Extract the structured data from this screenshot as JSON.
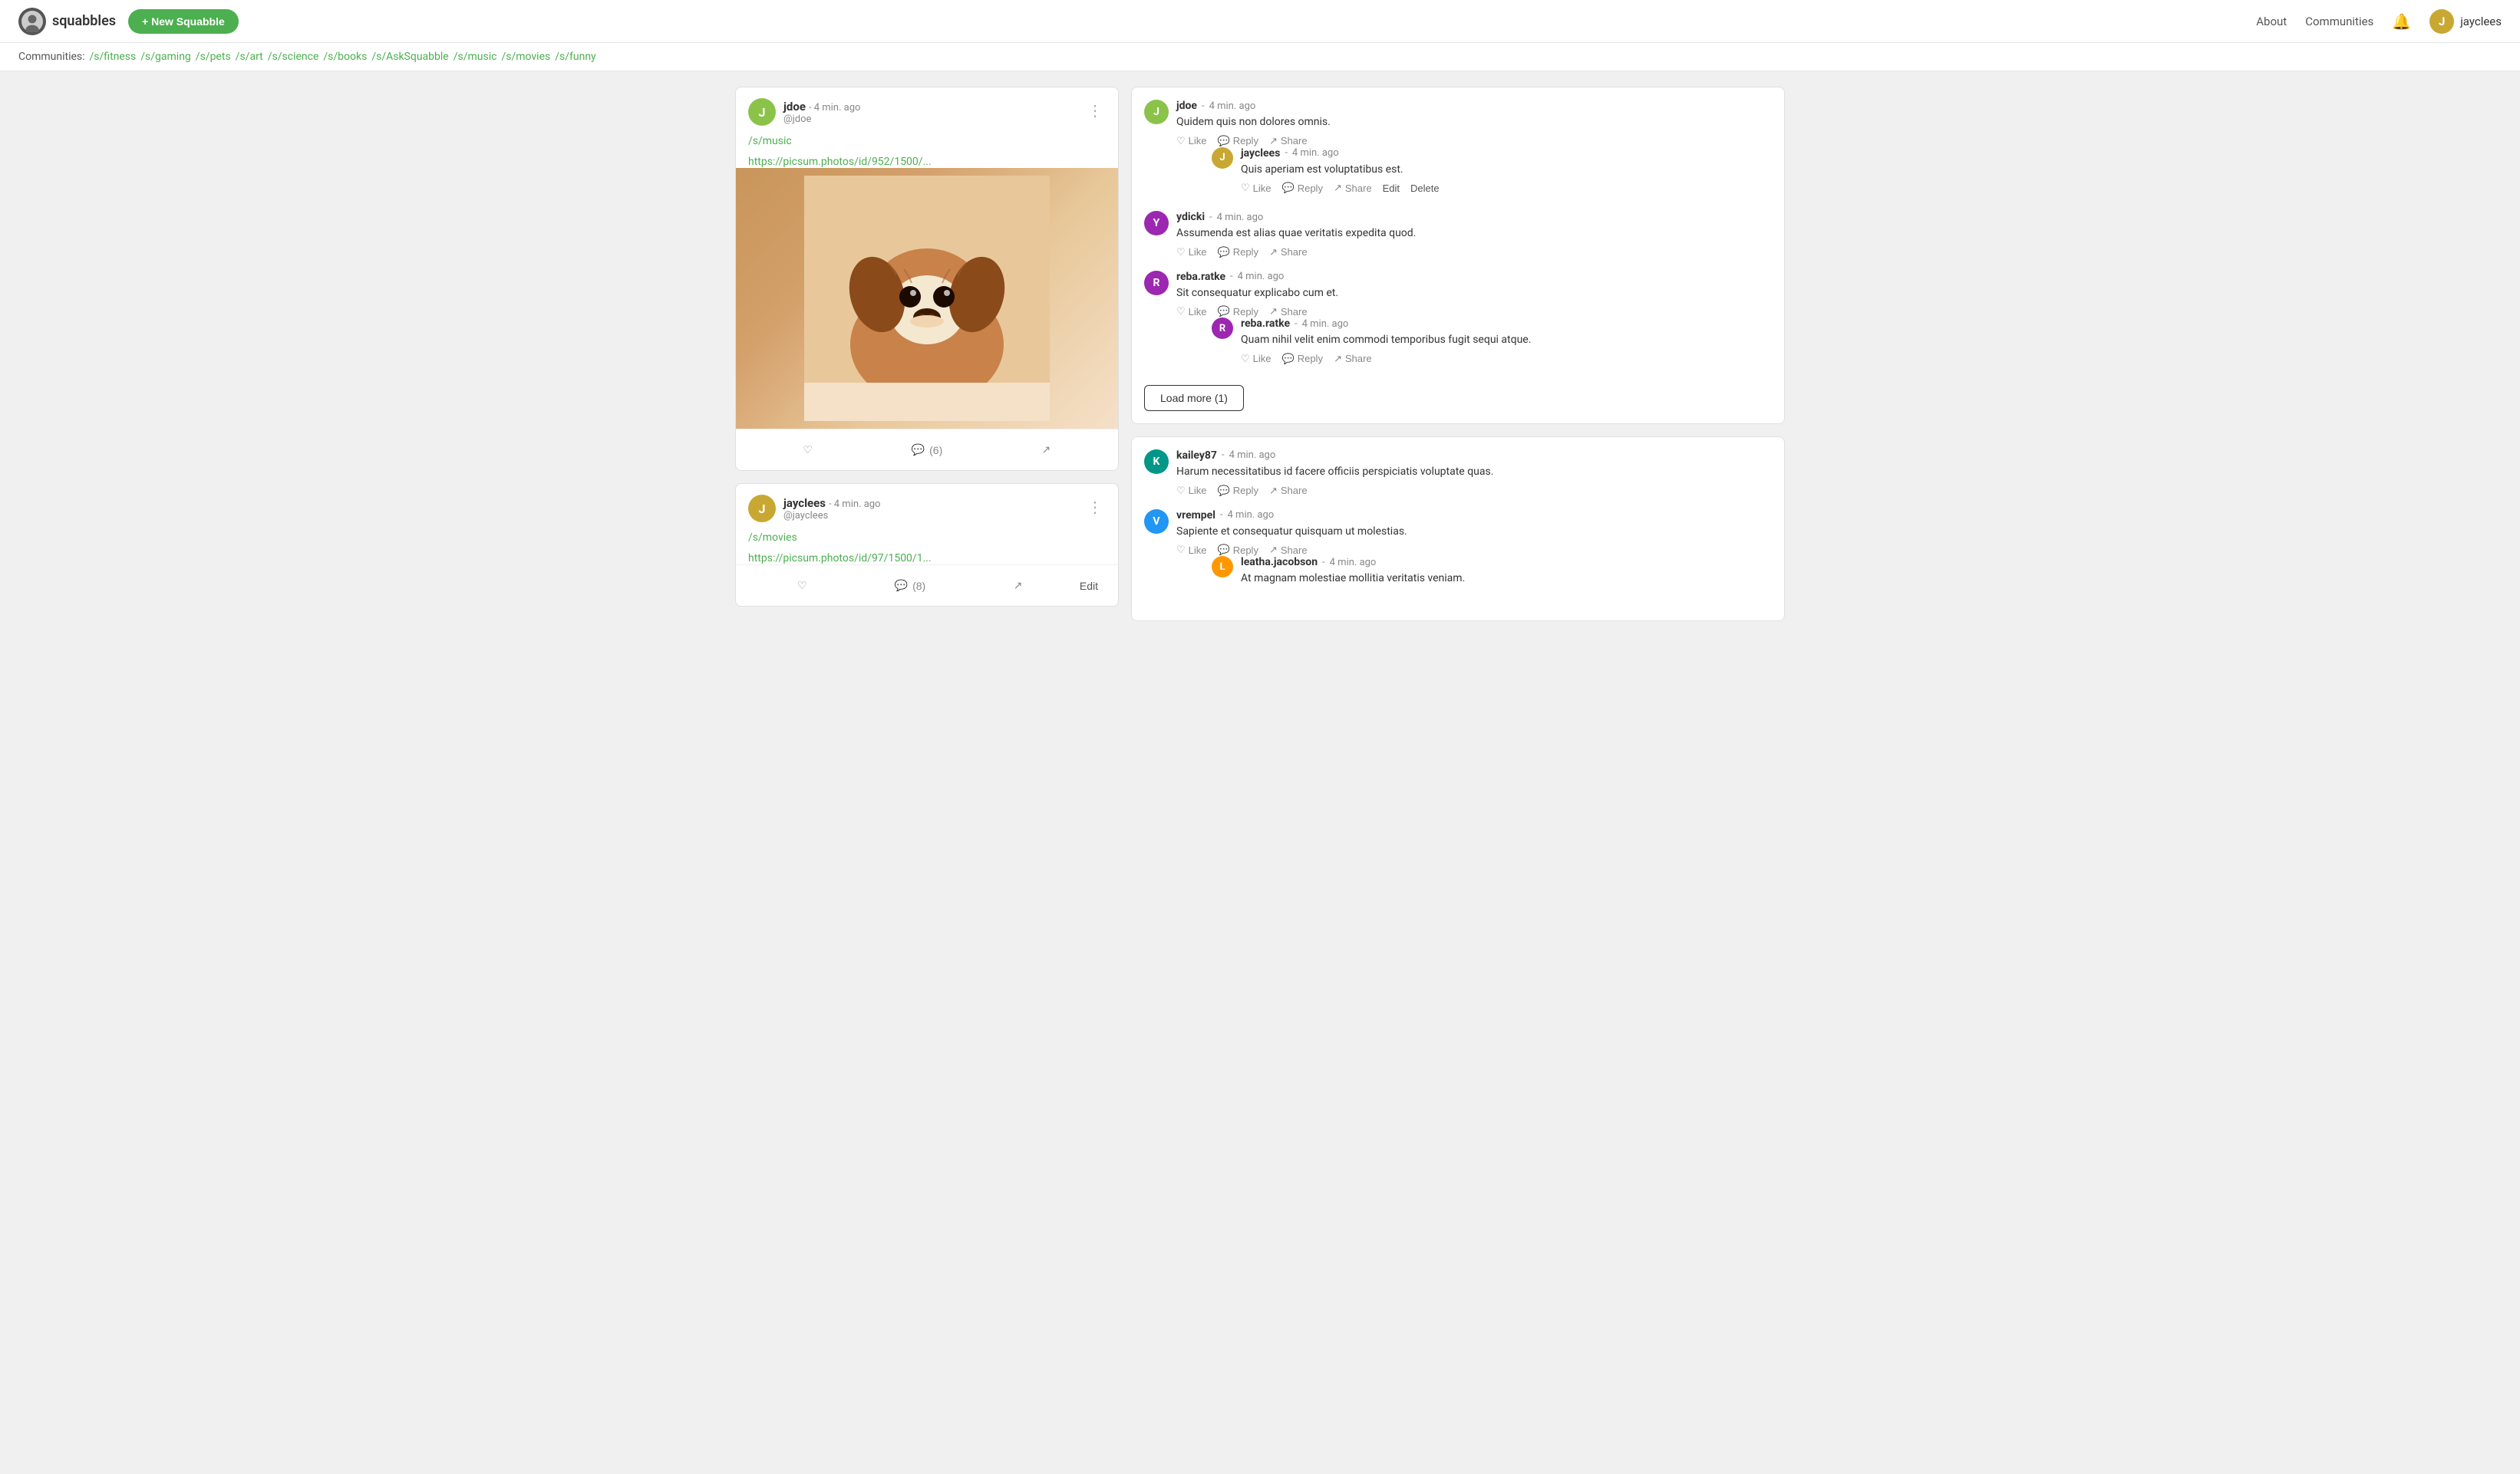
{
  "nav": {
    "brand": "squabbles",
    "new_squabble_label": "+ New Squabble",
    "about_label": "About",
    "communities_label": "Communities",
    "username": "jayclees",
    "username_initial": "J"
  },
  "communities_bar": {
    "label": "Communities:",
    "items": [
      "/s/fitness",
      "/s/gaming",
      "/s/pets",
      "/s/art",
      "/s/science",
      "/s/books",
      "/s/AskSquabble",
      "/s/music",
      "/s/movies",
      "/s/funny"
    ]
  },
  "post1": {
    "author": "jdoe",
    "handle": "@jdoe",
    "time": "4 min. ago",
    "community": "/s/music",
    "link": "https://picsum.photos/id/952/1500/...",
    "comments_count": "(6)",
    "avatar_initial": "J",
    "avatar_class": "avatar-green"
  },
  "post2": {
    "author": "jayclees",
    "handle": "@jayclees",
    "time": "4 min. ago",
    "community": "/s/movies",
    "link": "https://picsum.photos/id/97/1500/1...",
    "comments_count": "(8)",
    "avatar_initial": "J",
    "avatar_class": "avatar-yellow",
    "edit_label": "Edit"
  },
  "comments1": {
    "thread1": {
      "author": "jdoe",
      "time": "4 min. ago",
      "text": "Quidem quis non dolores omnis.",
      "avatar_initial": "J",
      "avatar_class": "avatar-green",
      "like": "Like",
      "reply": "Reply",
      "share": "Share",
      "nested": {
        "author": "jayclees",
        "time": "4 min. ago",
        "text": "Quis aperiam est voluptatibus est.",
        "avatar_initial": "J",
        "avatar_class": "avatar-yellow",
        "like": "Like",
        "reply": "Reply",
        "share": "Share",
        "edit": "Edit",
        "delete": "Delete"
      }
    },
    "thread2": {
      "author": "ydicki",
      "time": "4 min. ago",
      "text": "Assumenda est alias quae veritatis expedita quod.",
      "avatar_initial": "Y",
      "avatar_class": "avatar-purple",
      "like": "Like",
      "reply": "Reply",
      "share": "Share"
    },
    "thread3": {
      "author": "reba.ratke",
      "time": "4 min. ago",
      "text": "Sit consequatur explicabo cum et.",
      "avatar_initial": "R",
      "avatar_class": "avatar-purple",
      "like": "Like",
      "reply": "Reply",
      "share": "Share",
      "nested": {
        "author": "reba.ratke",
        "time": "4 min. ago",
        "text": "Quam nihil velit enim commodi temporibus fugit sequi atque.",
        "avatar_initial": "R",
        "avatar_class": "avatar-purple",
        "like": "Like",
        "reply": "Reply",
        "share": "Share"
      }
    },
    "load_more": "Load more (1)"
  },
  "comments2": {
    "thread1": {
      "author": "kailey87",
      "time": "4 min. ago",
      "text": "Harum necessitatibus id facere officiis perspiciatis voluptate quas.",
      "avatar_initial": "K",
      "avatar_class": "avatar-teal",
      "like": "Like",
      "reply": "Reply",
      "share": "Share"
    },
    "thread2": {
      "author": "vrempel",
      "time": "4 min. ago",
      "text": "Sapiente et consequatur quisquam ut molestias.",
      "avatar_initial": "V",
      "avatar_class": "avatar-blue",
      "like": "Like",
      "reply": "Reply",
      "share": "Share",
      "nested": {
        "author": "leatha.jacobson",
        "time": "4 min. ago",
        "text": "At magnam molestiae mollitia veritatis veniam.",
        "avatar_initial": "L",
        "avatar_class": "avatar-orange"
      }
    }
  }
}
